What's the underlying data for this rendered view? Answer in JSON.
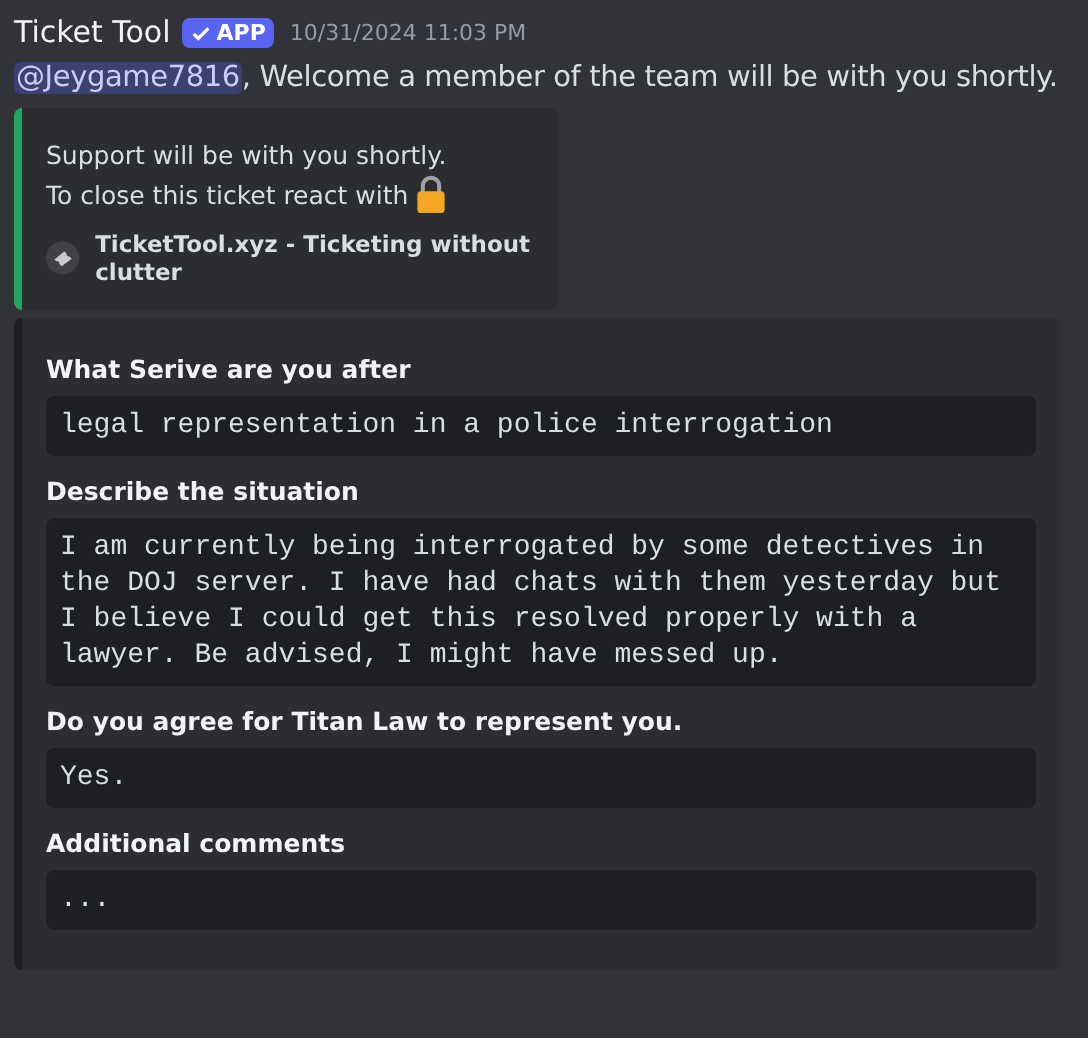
{
  "message": {
    "author": "Ticket Tool",
    "badge": "APP",
    "timestamp": "10/31/2024 11:03 PM",
    "mention": "@Jeygame7816",
    "text": ", Welcome a member of the team will be with you shortly."
  },
  "embeds": [
    {
      "kind": "description",
      "color": "#23a55a",
      "lines": [
        "Support will be with you shortly.",
        "To close this ticket react with"
      ],
      "footer": "TicketTool.xyz - Ticketing without clutter"
    },
    {
      "kind": "fields",
      "color": "#1e1f22",
      "fields": [
        {
          "name": "What Serive are you after",
          "value": "legal representation in a police interrogation"
        },
        {
          "name": "Describe the situation",
          "value": "I am currently being interrogated by some detectives in the DOJ server. I have had chats with them yesterday but I believe I could get this resolved properly with a lawyer. Be advised, I might have messed up."
        },
        {
          "name": "Do you agree for Titan Law to represent you.",
          "value": "Yes."
        },
        {
          "name": "Additional comments",
          "value": "..."
        }
      ]
    }
  ]
}
